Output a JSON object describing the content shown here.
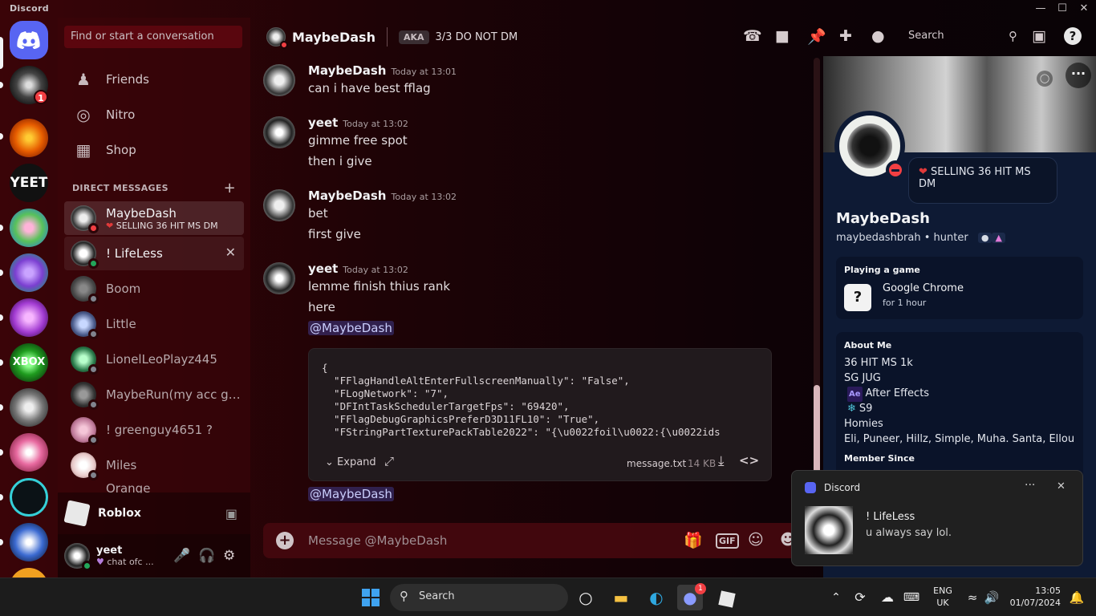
{
  "window": {
    "title": "Discord",
    "minimize": "—",
    "maximize": "☐",
    "close": "✕"
  },
  "rail": {
    "home_badge": "",
    "badges": {
      "server1": "1"
    }
  },
  "dm_sidebar": {
    "search_placeholder": "Find or start a conversation",
    "nav": [
      {
        "label": "Friends"
      },
      {
        "label": "Nitro"
      },
      {
        "label": "Shop"
      }
    ],
    "header": "DIRECT MESSAGES",
    "header_plus": "+",
    "dms": [
      {
        "name": "MaybeDash",
        "sub": "SELLING 36 HIT MS DM"
      },
      {
        "name": "! LifeLess"
      },
      {
        "name": "Boom"
      },
      {
        "name": "Little"
      },
      {
        "name": "LionelLeoPlayz445"
      },
      {
        "name": "MaybeRun(my acc got..."
      },
      {
        "name": "! greenguy4651 ?"
      },
      {
        "name": "Miles"
      },
      {
        "name": "Orange"
      }
    ],
    "activity": {
      "name": "Roblox"
    },
    "user": {
      "name": "yeet",
      "status": "chat ofc ..."
    }
  },
  "chat": {
    "header": {
      "name": "MaybeDash",
      "aka_label": "AKA",
      "aka": "3/3 DO NOT DM",
      "search": "Search"
    },
    "messages": [
      {
        "author": "MaybeDash",
        "time": "Today at 13:01",
        "lines": [
          "can i have best fflag"
        ]
      },
      {
        "author": "yeet",
        "time": "Today at 13:02",
        "lines": [
          "gimme free spot",
          "then i give"
        ]
      },
      {
        "author": "MaybeDash",
        "time": "Today at 13:02",
        "lines": [
          "bet",
          "first give"
        ]
      },
      {
        "author": "yeet",
        "time": "Today at 13:02",
        "lines": [
          "lemme finish thius rank",
          "here"
        ]
      }
    ],
    "mention1": "@MaybeDash",
    "mention2": "@MaybeDash",
    "attachment": {
      "code": "{\n  \"FFlagHandleAltEnterFullscreenManually\": \"False\",\n  \"FLogNetwork\": \"7\",\n  \"DFIntTaskSchedulerTargetFps\": \"69420\",\n  \"FFlagDebugGraphicsPreferD3D11FL10\": \"True\",\n  \"FStringPartTexturePackTable2022\": \"{\\u0022foil\\u0022:{\\u0022ids",
      "expand": "Expand",
      "filename": "message.txt",
      "size": "14 KB"
    },
    "composer_placeholder": "Message @MaybeDash"
  },
  "profile": {
    "custom_status": "SELLING 36 HIT MS DM",
    "name": "MaybeDash",
    "username": "maybedashbrah",
    "pronouns": "hunter",
    "playing_title": "Playing a game",
    "game": "Google Chrome",
    "game_time": "for 1 hour",
    "about_title": "About Me",
    "about": [
      "36 HIT MS 1k",
      "SG JUG",
      "After Effects",
      "S9",
      "Homies",
      "Eli, Puneer, Hillz, Simple, Muha. Santa, Ellou, ..."
    ],
    "member_since": "Member Since"
  },
  "toast": {
    "app": "Discord",
    "title": "! LifeLess",
    "body": "u always say lol."
  },
  "taskbar": {
    "search": "Search",
    "lang1": "ENG",
    "lang2": "UK",
    "time": "13:05",
    "date": "01/07/2024",
    "discord_badge": "1"
  },
  "colors": {
    "blurple": "#5865f2",
    "dnd": "#f23f43",
    "online": "#23a55a",
    "idle": "#80848e"
  }
}
